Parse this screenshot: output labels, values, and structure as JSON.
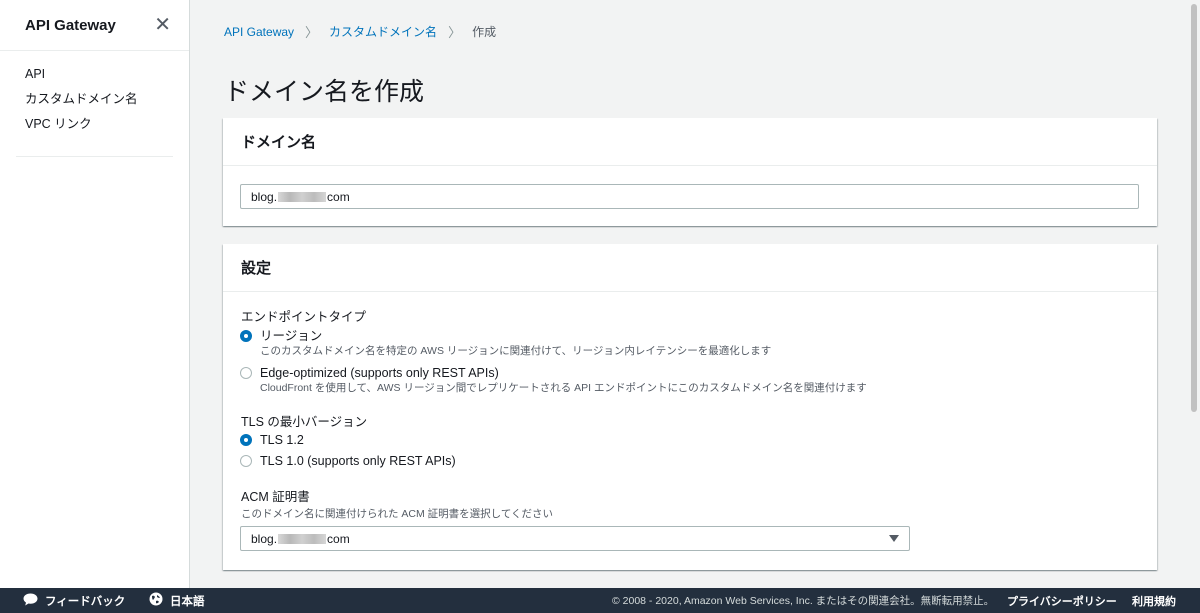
{
  "sidebar": {
    "title": "API Gateway",
    "items": [
      {
        "label": "API"
      },
      {
        "label": "カスタムドメイン名"
      },
      {
        "label": "VPC リンク"
      }
    ]
  },
  "breadcrumb": {
    "items": [
      "API Gateway",
      "カスタムドメイン名"
    ],
    "current": "作成"
  },
  "page": {
    "title": "ドメイン名を作成"
  },
  "domain_panel": {
    "header": "ドメイン名",
    "input_prefix": "blog.",
    "input_suffix": "com"
  },
  "settings_panel": {
    "header": "設定",
    "endpoint_type_label": "エンドポイントタイプ",
    "endpoint_options": [
      {
        "label": "リージョン",
        "desc": "このカスタムドメイン名を特定の AWS リージョンに関連付けて、リージョン内レイテンシーを最適化します",
        "checked": true
      },
      {
        "label": "Edge-optimized (supports only REST APIs)",
        "desc": "CloudFront を使用して、AWS リージョン間でレプリケートされる API エンドポイントにこのカスタムドメイン名を関連付けます",
        "checked": false
      }
    ],
    "tls_label": "TLS の最小バージョン",
    "tls_options": [
      {
        "label": "TLS 1.2",
        "checked": true
      },
      {
        "label": "TLS 1.0 (supports only REST APIs)",
        "checked": false
      }
    ],
    "acm_label": "ACM 証明書",
    "acm_desc": "このドメイン名に関連付けられた ACM 証明書を選択してください",
    "acm_prefix": "blog.",
    "acm_suffix": "com"
  },
  "footer": {
    "feedback": "フィードバック",
    "language": "日本語",
    "copyright": "© 2008 - 2020, Amazon Web Services, Inc. またはその関連会社。無断転用禁止。",
    "privacy": "プライバシーポリシー",
    "terms": "利用規約"
  },
  "colors": {
    "accent": "#0073bb",
    "footer_bg": "#232f3e",
    "page_bg": "#f2f3f3"
  }
}
